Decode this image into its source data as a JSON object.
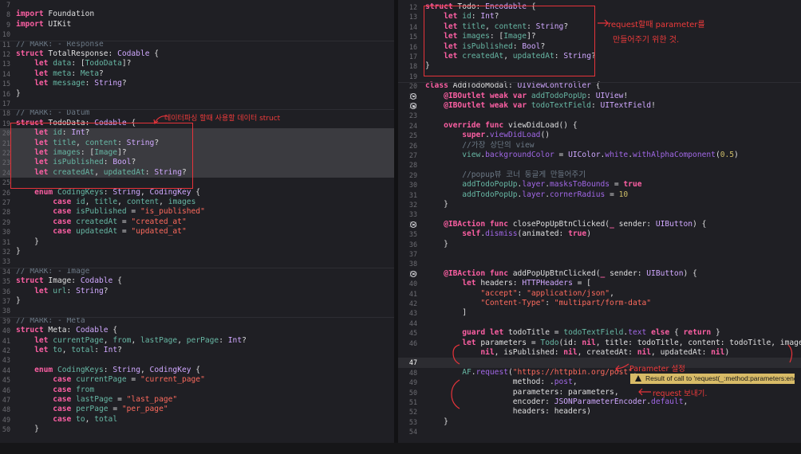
{
  "left_pane": {
    "lines": [
      {
        "n": "7",
        "html": ""
      },
      {
        "n": "8",
        "html": "<span class='k'>import</span> Foundation"
      },
      {
        "n": "9",
        "html": "<span class='k'>import</span> UIKit"
      },
      {
        "n": "10",
        "html": ""
      },
      {
        "n": "11",
        "html": "<span class='m'>// MARK: - Response</span>"
      },
      {
        "n": "12",
        "html": "<span class='k'>struct</span> TotalResponse: <span class='t'>Codable</span> {"
      },
      {
        "n": "13",
        "html": "    <span class='k'>let</span> <span class='p'>data</span>: [<span class='p'>TodoData</span>]?"
      },
      {
        "n": "14",
        "html": "    <span class='k'>let</span> <span class='p'>meta</span>: <span class='p'>Meta</span>?"
      },
      {
        "n": "15",
        "html": "    <span class='k'>let</span> <span class='p'>message</span>: <span class='t'>String</span>?"
      },
      {
        "n": "16",
        "html": "}"
      },
      {
        "n": "17",
        "html": ""
      },
      {
        "n": "18",
        "html": "<span class='m'>// MARK: - Datum</span>"
      },
      {
        "n": "19",
        "html": "<span class='k'>struct</span> TodoData: <span class='t'>Codable</span> {"
      },
      {
        "n": "20",
        "html": "    <span class='k'>let</span> <span class='p'>id</span>: <span class='t'>Int</span>?"
      },
      {
        "n": "21",
        "html": "    <span class='k'>let</span> <span class='p'>title</span>, <span class='p'>content</span>: <span class='t'>String</span>?"
      },
      {
        "n": "22",
        "html": "    <span class='k'>let</span> <span class='p'>images</span>: [<span class='p'>Image</span>]?"
      },
      {
        "n": "23",
        "html": "    <span class='k'>let</span> <span class='p'>isPublished</span>: <span class='t'>Bool</span>?"
      },
      {
        "n": "24",
        "html": "    <span class='k'>let</span> <span class='p'>createdAt</span>, <span class='p'>updatedAt</span>: <span class='t'>String</span>?"
      },
      {
        "n": "25",
        "html": ""
      },
      {
        "n": "26",
        "html": "    <span class='k'>enum</span> <span class='p'>CodingKeys</span>: <span class='t'>String</span>, <span class='t'>CodingKey</span> {"
      },
      {
        "n": "27",
        "html": "        <span class='k'>case</span> <span class='p'>id</span>, <span class='p'>title</span>, <span class='p'>content</span>, <span class='p'>images</span>"
      },
      {
        "n": "28",
        "html": "        <span class='k'>case</span> <span class='p'>isPublished</span> = <span class='s'>\"is_published\"</span>"
      },
      {
        "n": "29",
        "html": "        <span class='k'>case</span> <span class='p'>createdAt</span> = <span class='s'>\"created_at\"</span>"
      },
      {
        "n": "30",
        "html": "        <span class='k'>case</span> <span class='p'>updatedAt</span> = <span class='s'>\"updated_at\"</span>"
      },
      {
        "n": "31",
        "html": "    }"
      },
      {
        "n": "32",
        "html": "}"
      },
      {
        "n": "33",
        "html": ""
      },
      {
        "n": "34",
        "html": "<span class='m'>// MARK: - Image</span>"
      },
      {
        "n": "35",
        "html": "<span class='k'>struct</span> Image: <span class='t'>Codable</span> {"
      },
      {
        "n": "36",
        "html": "    <span class='k'>let</span> <span class='p'>url</span>: <span class='t'>String</span>?"
      },
      {
        "n": "37",
        "html": "}"
      },
      {
        "n": "38",
        "html": ""
      },
      {
        "n": "39",
        "html": "<span class='m'>// MARK: - Meta</span>"
      },
      {
        "n": "40",
        "html": "<span class='k'>struct</span> Meta: <span class='t'>Codable</span> {"
      },
      {
        "n": "41",
        "html": "    <span class='k'>let</span> <span class='p'>currentPage</span>, <span class='p'>from</span>, <span class='p'>lastPage</span>, <span class='p'>perPage</span>: <span class='t'>Int</span>?"
      },
      {
        "n": "42",
        "html": "    <span class='k'>let</span> <span class='p'>to</span>, <span class='p'>total</span>: <span class='t'>Int</span>?"
      },
      {
        "n": "43",
        "html": ""
      },
      {
        "n": "44",
        "html": "    <span class='k'>enum</span> <span class='p'>CodingKeys</span>: <span class='t'>String</span>, <span class='t'>CodingKey</span> {"
      },
      {
        "n": "45",
        "html": "        <span class='k'>case</span> <span class='p'>currentPage</span> = <span class='s'>\"current_page\"</span>"
      },
      {
        "n": "46",
        "html": "        <span class='k'>case</span> <span class='p'>from</span>"
      },
      {
        "n": "47",
        "html": "        <span class='k'>case</span> <span class='p'>lastPage</span> = <span class='s'>\"last_page\"</span>"
      },
      {
        "n": "48",
        "html": "        <span class='k'>case</span> <span class='p'>perPage</span> = <span class='s'>\"per_page\"</span>"
      },
      {
        "n": "49",
        "html": "        <span class='k'>case</span> <span class='p'>to</span>, <span class='p'>total</span>"
      },
      {
        "n": "50",
        "html": "    }"
      }
    ]
  },
  "right_pane": {
    "lines": [
      {
        "n": "12",
        "html": "<span class='k'>struct</span> Todo: <span class='t'>Encodable</span> {"
      },
      {
        "n": "13",
        "html": "    <span class='k'>let</span> <span class='p'>id</span>: <span class='t'>Int</span>?"
      },
      {
        "n": "14",
        "html": "    <span class='k'>let</span> <span class='p'>title</span>, <span class='p'>content</span>: <span class='t'>String</span>?"
      },
      {
        "n": "15",
        "html": "    <span class='k'>let</span> <span class='p'>images</span>: [<span class='p'>Image</span>]?"
      },
      {
        "n": "16",
        "html": "    <span class='k'>let</span> <span class='p'>isPublished</span>: <span class='t'>Bool</span>?"
      },
      {
        "n": "17",
        "html": "    <span class='k'>let</span> <span class='p'>createdAt</span>, <span class='p'>updatedAt</span>: <span class='t'>String</span>?"
      },
      {
        "n": "18",
        "html": "}"
      },
      {
        "n": "19",
        "html": ""
      },
      {
        "n": "20",
        "html": "<span class='k'>class</span> AddTodoModal: <span class='t'>UIViewController</span> {"
      },
      {
        "n": "21",
        "html": "    <span class='k'>@IBOutlet</span> <span class='k'>weak</span> <span class='k'>var</span> <span class='p'>addTodoPopUp</span>: <span class='t'>UIView</span>!"
      },
      {
        "n": "22",
        "html": "    <span class='k'>@IBOutlet</span> <span class='k'>weak</span> <span class='k'>var</span> <span class='p'>todoTextField</span>: <span class='t'>UITextField</span>!"
      },
      {
        "n": "23",
        "html": ""
      },
      {
        "n": "24",
        "html": "    <span class='k'>override</span> <span class='k'>func</span> viewDidLoad() {"
      },
      {
        "n": "25",
        "html": "        <span class='k'>super</span>.<span class='f'>viewDidLoad</span>()"
      },
      {
        "n": "26",
        "html": "        <span class='c'>//가장 상단의 view</span>"
      },
      {
        "n": "27",
        "html": "        <span class='p'>view</span>.<span class='f'>backgroundColor</span> = <span class='t'>UIColor</span>.<span class='f'>white</span>.<span class='f'>withAlphaComponent</span>(<span class='n'>0.5</span>)"
      },
      {
        "n": "28",
        "html": ""
      },
      {
        "n": "29",
        "html": "        <span class='c'>//popup뷰 코너 둥글게 만들어주기</span>"
      },
      {
        "n": "30",
        "html": "        <span class='p'>addTodoPopUp</span>.<span class='f'>layer</span>.<span class='f'>masksToBounds</span> = <span class='k'>true</span>"
      },
      {
        "n": "31",
        "html": "        <span class='p'>addTodoPopUp</span>.<span class='f'>layer</span>.<span class='f'>cornerRadius</span> = <span class='n'>10</span>"
      },
      {
        "n": "32",
        "html": "    }"
      },
      {
        "n": "33",
        "html": ""
      },
      {
        "n": "34",
        "html": "    <span class='k'>@IBAction</span> <span class='k'>func</span> closePopUpBtnClicked(<span class='k'>_</span> sender: <span class='t'>UIButton</span>) {"
      },
      {
        "n": "35",
        "html": "        <span class='k'>self</span>.<span class='f'>dismiss</span>(animated: <span class='k'>true</span>)"
      },
      {
        "n": "36",
        "html": "    }"
      },
      {
        "n": "37",
        "html": ""
      },
      {
        "n": "38",
        "html": ""
      },
      {
        "n": "39",
        "html": "    <span class='k'>@IBAction</span> <span class='k'>func</span> addPopUpBtnClicked(<span class='k'>_</span> sender: <span class='t'>UIButton</span>) {"
      },
      {
        "n": "40",
        "html": "        <span class='k'>let</span> headers: <span class='t'>HTTPHeaders</span> = ["
      },
      {
        "n": "41",
        "html": "            <span class='s'>\"accept\"</span>: <span class='s'>\"application/json\"</span>,"
      },
      {
        "n": "42",
        "html": "            <span class='s'>\"Content-Type\"</span>: <span class='s'>\"multipart/form-data\"</span>"
      },
      {
        "n": "43",
        "html": "        ]"
      },
      {
        "n": "44",
        "html": ""
      },
      {
        "n": "45",
        "html": "        <span class='k'>guard</span> <span class='k'>let</span> todoTitle = <span class='p'>todoTextField</span>.<span class='f'>text</span> <span class='k'>else</span> { <span class='k'>return</span> }"
      },
      {
        "n": "46",
        "html": "        <span class='k'>let</span> parameters = <span class='p'>Todo</span>(id: <span class='k'>nil</span>, title: todoTitle, content: todoTitle, images:"
      },
      {
        "n": "",
        "html": "            <span class='k'>nil</span>, isPublished: <span class='k'>nil</span>, createdAt: <span class='k'>nil</span>, updatedAt: <span class='k'>nil</span>)"
      },
      {
        "n": "47",
        "html": ""
      },
      {
        "n": "48",
        "html": "        <span class='p'>AF</span>.<span class='f'>request</span>(<span class='s'>\"https://httpbin.org/post\"</span>,"
      },
      {
        "n": "49",
        "html": "                   method: .<span class='f'>post</span>,"
      },
      {
        "n": "50",
        "html": "                   parameters: parameters,"
      },
      {
        "n": "51",
        "html": "                   encoder: <span class='t'>JSONParameterEncoder</span>.<span class='f'>default</span>,"
      },
      {
        "n": "52",
        "html": "                   headers: headers)"
      },
      {
        "n": "53",
        "html": "    }"
      },
      {
        "n": "54",
        "html": ""
      }
    ]
  },
  "annotations": {
    "left_note": "데이터파싱 할때 사용할 데이터 struct",
    "right_note_1": "request할때 parameter를",
    "right_note_2": "만들어주기 위한 것.",
    "param_note": "Parameter 설정",
    "request_note": "request 보내기."
  },
  "warning": {
    "text": "Result of call to 'request(_:method:parameters:encoder:headers:interceptor:requestModifier:)' is unused"
  },
  "colors": {
    "background": "#1f1f24",
    "keyword": "#fc5fa3",
    "string": "#fc6a5d",
    "annotation": "#e6333a",
    "warning": "#d8bb67"
  }
}
